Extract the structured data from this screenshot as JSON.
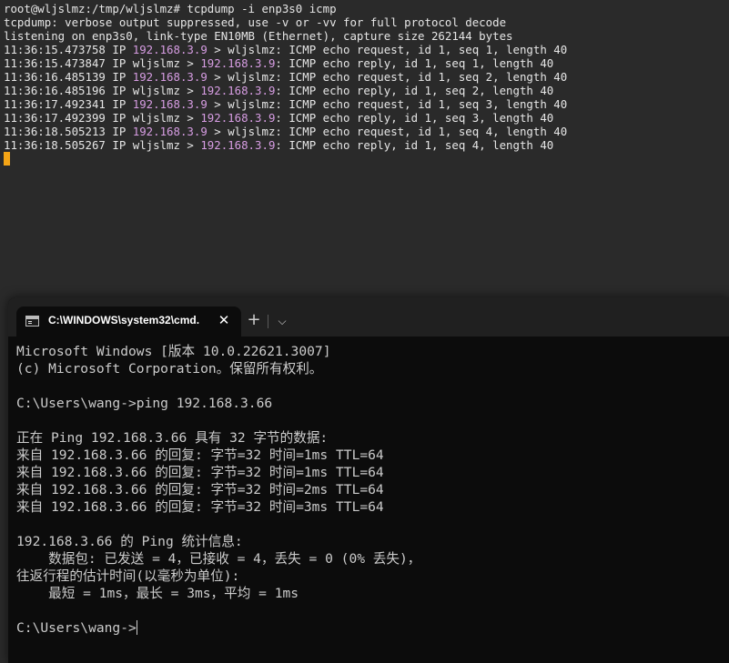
{
  "linux_terminal": {
    "lines": [
      {
        "text": "root@wljslmz:/tmp/wljslmz# tcpdump -i enp3s0 icmp"
      },
      {
        "text": "tcpdump: verbose output suppressed, use -v or -vv for full protocol decode"
      },
      {
        "text": "listening on enp3s0, link-type EN10MB (Ethernet), capture size 262144 bytes"
      },
      {
        "pre": "11:36:15.473758 IP ",
        "ip": "192.168.3.9",
        "post": " > wljslmz: ICMP echo request, id 1, seq 1, length 40"
      },
      {
        "pre": "11:36:15.473847 IP wljslmz > ",
        "ip": "192.168.3.9",
        "post": ": ICMP echo reply, id 1, seq 1, length 40"
      },
      {
        "pre": "11:36:16.485139 IP ",
        "ip": "192.168.3.9",
        "post": " > wljslmz: ICMP echo request, id 1, seq 2, length 40"
      },
      {
        "pre": "11:36:16.485196 IP wljslmz > ",
        "ip": "192.168.3.9",
        "post": ": ICMP echo reply, id 1, seq 2, length 40"
      },
      {
        "pre": "11:36:17.492341 IP ",
        "ip": "192.168.3.9",
        "post": " > wljslmz: ICMP echo request, id 1, seq 3, length 40"
      },
      {
        "pre": "11:36:17.492399 IP wljslmz > ",
        "ip": "192.168.3.9",
        "post": ": ICMP echo reply, id 1, seq 3, length 40"
      },
      {
        "pre": "11:36:18.505213 IP ",
        "ip": "192.168.3.9",
        "post": " > wljslmz: ICMP echo request, id 1, seq 4, length 40"
      },
      {
        "pre": "11:36:18.505267 IP wljslmz > ",
        "ip": "192.168.3.9",
        "post": ": ICMP echo reply, id 1, seq 4, length 40"
      }
    ],
    "cursor_color": "#f4a516",
    "ip_color": "#d79de3"
  },
  "windows_terminal": {
    "tab": {
      "title": "C:\\WINDOWS\\system32\\cmd.",
      "icon": "cmd-icon",
      "close_label": "✕"
    },
    "new_tab_label": "+",
    "dropdown_label": "⌵",
    "lines": [
      "Microsoft Windows [版本 10.0.22621.3007]",
      "(c) Microsoft Corporation。保留所有权利。",
      "",
      "C:\\Users\\wang->ping 192.168.3.66",
      "",
      "正在 Ping 192.168.3.66 具有 32 字节的数据:",
      "来自 192.168.3.66 的回复: 字节=32 时间=1ms TTL=64",
      "来自 192.168.3.66 的回复: 字节=32 时间=1ms TTL=64",
      "来自 192.168.3.66 的回复: 字节=32 时间=2ms TTL=64",
      "来自 192.168.3.66 的回复: 字节=32 时间=3ms TTL=64",
      "",
      "192.168.3.66 的 Ping 统计信息:",
      "    数据包: 已发送 = 4，已接收 = 4，丢失 = 0 (0% 丢失)，",
      "往返行程的估计时间(以毫秒为单位):",
      "    最短 = 1ms，最长 = 3ms，平均 = 1ms",
      ""
    ],
    "prompt": "C:\\Users\\wang->"
  }
}
